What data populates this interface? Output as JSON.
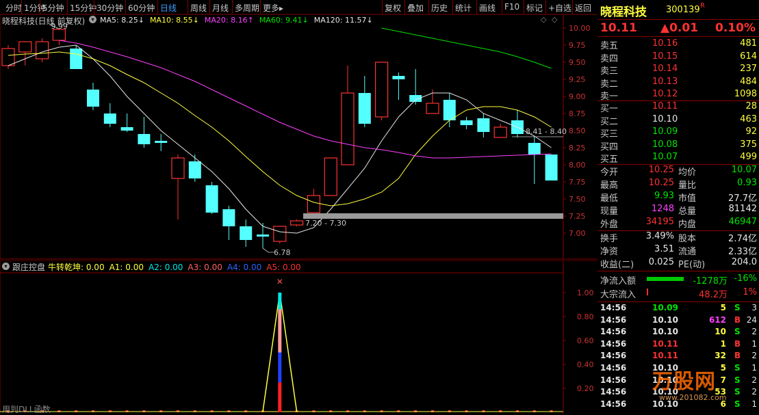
{
  "toolbar": {
    "tabs": [
      "分时",
      "1分钟",
      "5分钟",
      "15分钟",
      "30分钟",
      "60分钟",
      "日线",
      "周线",
      "月线",
      "多周期",
      "更多"
    ],
    "active_tab": "日线",
    "more_suffix": "▸",
    "right_buttons": [
      "复权",
      "叠加",
      "历史",
      "统计",
      "画线",
      "F10",
      "标记",
      "+自选",
      "返回"
    ]
  },
  "chart": {
    "stock_title": "晓程科技(日线 前复权)",
    "ma_labels": [
      {
        "text": "MA5: 8.25↓",
        "color": "#e6e6e6"
      },
      {
        "text": "MA10: 8.55↓",
        "color": "#ffff3f"
      },
      {
        "text": "MA20: 8.16↑",
        "color": "#ff40ff"
      },
      {
        "text": "MA60: 9.41↓",
        "color": "#00e600"
      },
      {
        "text": "MA120: 11.57↓",
        "color": "#e6e6e6"
      }
    ],
    "y_ticks": [
      "10.00",
      "9.75",
      "9.50",
      "9.25",
      "9.00",
      "8.75",
      "8.50",
      "8.25",
      "8.00",
      "7.75",
      "7.50",
      "7.25",
      "7.00"
    ],
    "annotations": {
      "high": "9.99",
      "low": "6.78",
      "range1": "7.20 - 7.30",
      "range2": "8.41 - 8.40"
    },
    "candles": [
      {
        "o": 9.45,
        "h": 9.75,
        "l": 9.4,
        "c": 9.7
      },
      {
        "o": 9.65,
        "h": 9.78,
        "l": 9.45,
        "c": 9.8
      },
      {
        "o": 9.55,
        "h": 9.85,
        "l": 9.5,
        "c": 9.8
      },
      {
        "o": 9.82,
        "h": 9.99,
        "l": 9.75,
        "c": 9.98
      },
      {
        "o": 9.7,
        "h": 9.75,
        "l": 9.45,
        "c": 9.4
      },
      {
        "o": 9.1,
        "h": 9.2,
        "l": 8.8,
        "c": 8.85
      },
      {
        "o": 8.75,
        "h": 8.9,
        "l": 8.55,
        "c": 8.6
      },
      {
        "o": 8.55,
        "h": 8.75,
        "l": 8.48,
        "c": 8.5
      },
      {
        "o": 8.45,
        "h": 8.7,
        "l": 8.25,
        "c": 8.3
      },
      {
        "o": 8.35,
        "h": 8.45,
        "l": 8.2,
        "c": 8.32
      },
      {
        "o": 7.8,
        "h": 8.15,
        "l": 7.2,
        "c": 8.1
      },
      {
        "o": 8.05,
        "h": 8.15,
        "l": 7.75,
        "c": 7.8
      },
      {
        "o": 7.7,
        "h": 7.75,
        "l": 7.28,
        "c": 7.3
      },
      {
        "o": 7.35,
        "h": 7.4,
        "l": 6.9,
        "c": 7.1
      },
      {
        "o": 7.1,
        "h": 7.2,
        "l": 6.8,
        "c": 6.9
      },
      {
        "o": 6.98,
        "h": 7.15,
        "l": 6.78,
        "c": 6.95
      },
      {
        "o": 6.88,
        "h": 7.1,
        "l": 6.85,
        "c": 7.1
      },
      {
        "o": 7.12,
        "h": 7.2,
        "l": 7.1,
        "c": 7.18
      },
      {
        "o": 7.3,
        "h": 7.65,
        "l": 7.3,
        "c": 7.55
      },
      {
        "o": 7.55,
        "h": 8.1,
        "l": 7.55,
        "c": 8.1
      },
      {
        "o": 8.0,
        "h": 9.45,
        "l": 8.0,
        "c": 9.05
      },
      {
        "o": 9.05,
        "h": 9.3,
        "l": 8.55,
        "c": 8.6
      },
      {
        "o": 8.7,
        "h": 9.5,
        "l": 8.65,
        "c": 9.5
      },
      {
        "o": 9.3,
        "h": 9.35,
        "l": 8.95,
        "c": 9.25
      },
      {
        "o": 9.02,
        "h": 9.4,
        "l": 8.88,
        "c": 8.92
      },
      {
        "o": 8.75,
        "h": 9.1,
        "l": 8.75,
        "c": 8.9
      },
      {
        "o": 8.95,
        "h": 9.05,
        "l": 8.55,
        "c": 8.65
      },
      {
        "o": 8.65,
        "h": 8.7,
        "l": 8.52,
        "c": 8.58
      },
      {
        "o": 8.68,
        "h": 8.75,
        "l": 8.4,
        "c": 8.48
      },
      {
        "o": 8.4,
        "h": 8.6,
        "l": 8.4,
        "c": 8.55
      },
      {
        "o": 8.65,
        "h": 8.8,
        "l": 8.4,
        "c": 8.45
      },
      {
        "o": 8.32,
        "h": 8.42,
        "l": 7.72,
        "c": 8.15
      },
      {
        "o": 8.15,
        "h": 8.15,
        "l": 7.78,
        "c": 7.77
      }
    ],
    "ma5": [
      9.45,
      9.55,
      9.65,
      9.72,
      9.75,
      9.55,
      9.3,
      9.0,
      8.75,
      8.5,
      8.3,
      8.1,
      7.9,
      7.65,
      7.35,
      7.1,
      7.02,
      7.0,
      7.08,
      7.35,
      7.65,
      7.95,
      8.35,
      8.7,
      8.95,
      9.05,
      9.05,
      8.95,
      8.75,
      8.65,
      8.55,
      8.42,
      8.25
    ],
    "ma10": [
      9.6,
      9.62,
      9.63,
      9.65,
      9.62,
      9.55,
      9.45,
      9.32,
      9.2,
      9.05,
      8.9,
      8.72,
      8.55,
      8.35,
      8.12,
      7.9,
      7.7,
      7.55,
      7.45,
      7.4,
      7.43,
      7.5,
      7.6,
      7.8,
      8.15,
      8.42,
      8.65,
      8.8,
      8.85,
      8.85,
      8.8,
      8.7,
      8.55
    ],
    "ma20": [
      null,
      null,
      null,
      9.82,
      9.78,
      9.72,
      9.65,
      9.58,
      9.5,
      9.42,
      9.32,
      9.22,
      9.1,
      8.98,
      8.86,
      8.74,
      8.62,
      8.52,
      8.42,
      8.35,
      8.3,
      8.25,
      8.22,
      8.18,
      8.13,
      8.1,
      8.1,
      8.11,
      8.12,
      8.13,
      8.14,
      8.15,
      8.16
    ],
    "ma60": [
      null,
      null,
      null,
      null,
      null,
      null,
      null,
      null,
      null,
      null,
      null,
      null,
      null,
      null,
      null,
      null,
      null,
      null,
      null,
      null,
      null,
      null,
      10.0,
      9.95,
      9.9,
      9.85,
      9.8,
      9.75,
      9.7,
      9.65,
      9.58,
      9.5,
      9.41
    ]
  },
  "indicator": {
    "title": "跟庄控盘",
    "labels": [
      {
        "text": "牛转乾坤: 0.00",
        "color": "#ffff3f"
      },
      {
        "text": "A1: 0.00",
        "color": "#ffff3f"
      },
      {
        "text": "A2: 0.00",
        "color": "#00e6e6"
      },
      {
        "text": "A3: 0.00",
        "color": "#ff6060"
      },
      {
        "text": "A4: 0.00",
        "color": "#3060ff"
      },
      {
        "text": "A5: 0.00",
        "color": "#ff3232"
      }
    ],
    "y_ticks": [
      "1.00",
      "0.80",
      "0.60",
      "0.40",
      "0.20"
    ],
    "spike_index": 16,
    "spike_value": 1.0,
    "footer": "用到DLL函数"
  },
  "quote": {
    "name": "晓程科技",
    "code": "300139",
    "badge": "R",
    "price": "10.11",
    "change": "▲0.01",
    "change_pct": "0.10%",
    "asks": [
      {
        "label": "卖五",
        "price": "10.16",
        "vol": "481"
      },
      {
        "label": "卖四",
        "price": "10.15",
        "vol": "614"
      },
      {
        "label": "卖三",
        "price": "10.14",
        "vol": "237"
      },
      {
        "label": "卖二",
        "price": "10.13",
        "vol": "484"
      },
      {
        "label": "卖一",
        "price": "10.12",
        "vol": "1098"
      }
    ],
    "bids": [
      {
        "label": "买一",
        "price": "10.11",
        "vol": "28",
        "pc": "red"
      },
      {
        "label": "买二",
        "price": "10.10",
        "vol": "463",
        "pc": "white"
      },
      {
        "label": "买三",
        "price": "10.09",
        "vol": "92",
        "pc": "green"
      },
      {
        "label": "买四",
        "price": "10.08",
        "vol": "375",
        "pc": "green"
      },
      {
        "label": "买五",
        "price": "10.07",
        "vol": "499",
        "pc": "green"
      }
    ],
    "stats": [
      {
        "k1": "今开",
        "v1": "10.25",
        "c1": "red",
        "k2": "均价",
        "v2": "10.07",
        "c2": "green"
      },
      {
        "k1": "最高",
        "v1": "10.25",
        "c1": "red",
        "k2": "量比",
        "v2": "0.93",
        "c2": "green"
      },
      {
        "k1": "最低",
        "v1": "9.93",
        "c1": "green",
        "k2": "市值",
        "v2": "27.7亿",
        "c2": "white"
      },
      {
        "k1": "现量",
        "v1": "1248",
        "c1": "magenta",
        "k2": "总量",
        "v2": "81142",
        "c2": "white"
      },
      {
        "k1": "外盘",
        "v1": "34195",
        "c1": "red",
        "k2": "内盘",
        "v2": "46947",
        "c2": "green"
      }
    ],
    "stats2": [
      {
        "k1": "换手",
        "v1": "3.49%",
        "c1": "white",
        "k2": "股本",
        "v2": "2.74亿",
        "c2": "white"
      },
      {
        "k1": "净资",
        "v1": "3.51",
        "c1": "white",
        "k2": "流通",
        "v2": "2.33亿",
        "c2": "white"
      },
      {
        "k1": "收益(二)",
        "v1": "0.025",
        "c1": "white",
        "k2": "PE(动)",
        "v2": "204.0",
        "c2": "white"
      }
    ],
    "flow": [
      {
        "label": "净流入额",
        "value": "-1278万",
        "pct": "-16%",
        "color": "green",
        "bar": true
      },
      {
        "label": "大宗流入",
        "value": "48.2万",
        "pct": "1%",
        "color": "red",
        "bar": false
      }
    ],
    "ticks": [
      {
        "t": "14:56",
        "p": "10.09",
        "pc": "green",
        "v": "5",
        "vc": "yellow",
        "s": "S",
        "sc": "green",
        "n": "3"
      },
      {
        "t": "14:56",
        "p": "10.10",
        "pc": "white",
        "v": "612",
        "vc": "magenta",
        "s": "B",
        "sc": "red",
        "n": "24"
      },
      {
        "t": "14:56",
        "p": "10.10",
        "pc": "white",
        "v": "10",
        "vc": "yellow",
        "s": "S",
        "sc": "green",
        "n": "2"
      },
      {
        "t": "14:56",
        "p": "10.11",
        "pc": "red",
        "v": "1",
        "vc": "yellow",
        "s": "B",
        "sc": "red",
        "n": "1"
      },
      {
        "t": "14:56",
        "p": "10.11",
        "pc": "red",
        "v": "32",
        "vc": "yellow",
        "s": "B",
        "sc": "red",
        "n": "2"
      },
      {
        "t": "14:56",
        "p": "10.10",
        "pc": "white",
        "v": "5",
        "vc": "yellow",
        "s": "S",
        "sc": "green",
        "n": "1"
      },
      {
        "t": "14:56",
        "p": "10.10",
        "pc": "white",
        "v": "7",
        "vc": "yellow",
        "s": "S",
        "sc": "green",
        "n": "2"
      },
      {
        "t": "14:56",
        "p": "10.10",
        "pc": "white",
        "v": "53",
        "vc": "yellow",
        "s": "S",
        "sc": "green",
        "n": "2"
      },
      {
        "t": "14:56",
        "p": "10.10",
        "pc": "white",
        "v": "6",
        "vc": "yellow",
        "s": "S",
        "sc": "green",
        "n": "1"
      }
    ],
    "watermark": "万股网",
    "watermark_url": "www.201082.com"
  },
  "colors": {
    "up": "#ff3232",
    "down": "#54ffff",
    "frame": "#8b0000",
    "ma5": "#e6e6e6",
    "ma10": "#ffff3f",
    "ma20": "#ff40ff",
    "ma60": "#00e600"
  }
}
